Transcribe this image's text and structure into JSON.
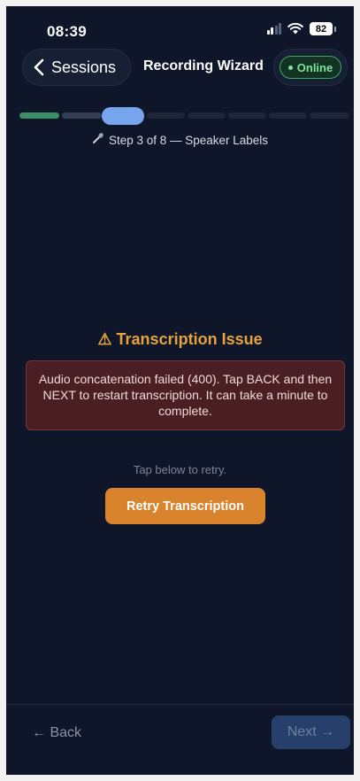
{
  "status_bar": {
    "time": "08:39",
    "battery": "82"
  },
  "nav": {
    "back_label": "Sessions",
    "title": "Recording Wizard",
    "status_badge": "Online"
  },
  "progress": {
    "current_step": 3,
    "total_steps": 8,
    "label": "Step 3 of 8 — Speaker Labels",
    "label_icon": "microphone-icon"
  },
  "issue": {
    "title": "⚠ Transcription Issue",
    "message": "Audio concatenation failed (400). Tap BACK and then NEXT to restart transcription. It can take a minute to complete.",
    "hint": "Tap below to retry.",
    "retry_label": "Retry Transcription"
  },
  "footer": {
    "back_label": "← Back",
    "next_label": "Next →"
  },
  "colors": {
    "background": "#0f1629",
    "accent_orange": "#d9832c",
    "warning_text": "#e8a23c",
    "online_green": "#7fe39a",
    "step_done": "#3c8f67",
    "step_current": "#76a5ee",
    "error_bg": "#4a1f24"
  }
}
